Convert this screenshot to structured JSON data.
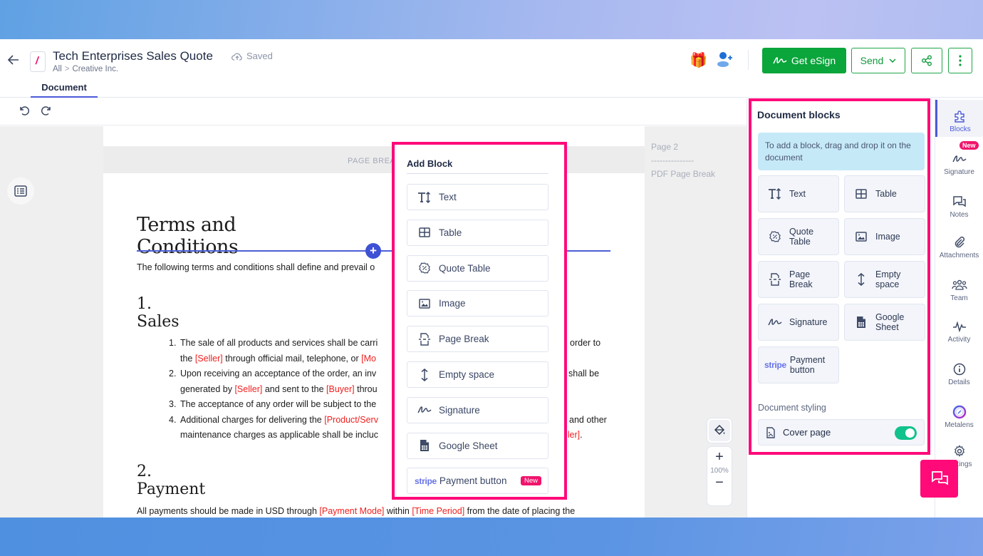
{
  "header": {
    "title": "Tech Enterprises Sales Quote",
    "saved_status": "Saved",
    "breadcrumb": [
      "All",
      "Creative Inc."
    ],
    "tab": "Document",
    "buttons": {
      "esign": "Get eSign",
      "send": "Send"
    }
  },
  "canvas": {
    "page_break_label": "PAGE BREAK",
    "side_note": {
      "page": "Page 2",
      "dashes": "---------------",
      "label": "PDF Page Break"
    },
    "heading": "Terms and Conditions",
    "intro": "The following terms and conditions shall define and prevail o",
    "section1": "1. Sales",
    "list": [
      {
        "num": "1.",
        "parts": [
          {
            "t": "The sale of all products and services shall be carri"
          }
        ],
        "right": "order to"
      },
      {
        "num": "",
        "parts": [
          {
            "t": "the "
          },
          {
            "t": "[Seller]",
            "ph": true
          },
          {
            "t": " through official mail, telephone, or "
          },
          {
            "t": "[Mo",
            "ph": true
          }
        ],
        "right": ""
      },
      {
        "num": "2.",
        "parts": [
          {
            "t": "Upon receiving an acceptance of the order, an inv"
          }
        ],
        "right": "shall be"
      },
      {
        "num": "",
        "parts": [
          {
            "t": "generated by "
          },
          {
            "t": "[Seller]",
            "ph": true
          },
          {
            "t": " and sent to the "
          },
          {
            "t": "[Buyer]",
            "ph": true
          },
          {
            "t": " throu"
          }
        ],
        "right": ""
      },
      {
        "num": "3.",
        "parts": [
          {
            "t": "The acceptance of any order will be subject to the"
          }
        ],
        "right": ""
      },
      {
        "num": "4.",
        "parts": [
          {
            "t": "Additional charges for delivering the "
          },
          {
            "t": "[Product/Serv",
            "ph": true
          }
        ],
        "right": "and other"
      },
      {
        "num": "",
        "parts": [
          {
            "t": "maintenance charges as applicable shall be incluc"
          }
        ],
        "right_ph": "ller]",
        "right_tail": "."
      }
    ],
    "section2": "2. Payment",
    "payment_para": [
      {
        "t": "All payments should be made in USD through "
      },
      {
        "t": "[Payment Mode]",
        "ph": true
      },
      {
        "t": " within "
      },
      {
        "t": "[Time Period]",
        "ph": true
      },
      {
        "t": " from the date of placing the"
      }
    ],
    "zoom_level": "100%"
  },
  "add_block": {
    "title": "Add Block",
    "items": [
      {
        "label": "Text",
        "icon": "text-icon"
      },
      {
        "label": "Table",
        "icon": "table-icon"
      },
      {
        "label": "Quote Table",
        "icon": "quote-table-icon"
      },
      {
        "label": "Image",
        "icon": "image-icon"
      },
      {
        "label": "Page Break",
        "icon": "page-break-icon"
      },
      {
        "label": "Empty space",
        "icon": "empty-space-icon"
      },
      {
        "label": "Signature",
        "icon": "signature-icon"
      },
      {
        "label": "Google Sheet",
        "icon": "google-sheet-icon"
      },
      {
        "label": "Payment button",
        "icon": "stripe-icon",
        "prefix": "stripe",
        "badge": "New"
      }
    ]
  },
  "panel": {
    "title": "Document blocks",
    "hint": "To add a block, drag and drop it on the document",
    "blocks": [
      {
        "label": "Text"
      },
      {
        "label": "Table"
      },
      {
        "label": "Quote\nTable"
      },
      {
        "label": "Image"
      },
      {
        "label": "Page\nBreak"
      },
      {
        "label": "Empty\nspace"
      },
      {
        "label": "Signature"
      },
      {
        "label": "Google\nSheet"
      },
      {
        "label": "Payment\nbutton",
        "prefix": "stripe"
      }
    ],
    "styling_label": "Document styling",
    "cover_page": {
      "label": "Cover page",
      "enabled": true
    }
  },
  "rail": {
    "items": [
      {
        "label": "Blocks",
        "active": true
      },
      {
        "label": "Signature",
        "badge": "New"
      },
      {
        "label": "Notes"
      },
      {
        "label": "Attachments"
      },
      {
        "label": "Team"
      },
      {
        "label": "Activity"
      },
      {
        "label": "Details"
      },
      {
        "label": "Metalens"
      },
      {
        "label": "Settings"
      }
    ]
  },
  "colors": {
    "accent": "#4a5ad9",
    "esign_green": "#0aa53b",
    "highlight_pink": "#ff0a7a",
    "placeholder_red": "#f0201f",
    "toggle_on": "#11c28c"
  }
}
